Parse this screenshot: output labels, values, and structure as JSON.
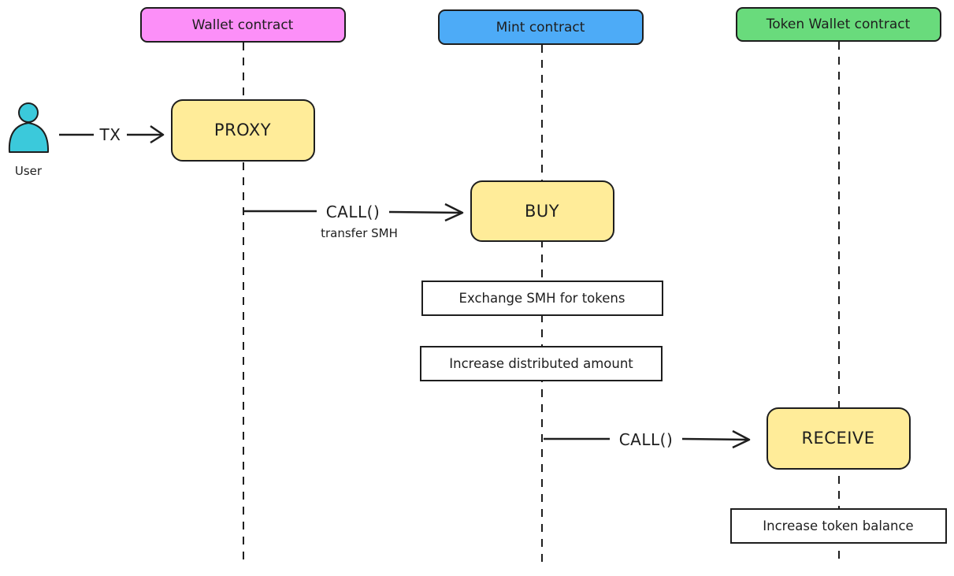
{
  "lanes": [
    {
      "title": "Wallet contract",
      "color": "#fc8ff8"
    },
    {
      "title": "Mint contract",
      "color": "#4dabf7"
    },
    {
      "title": "Token Wallet contract",
      "color": "#69db7c"
    }
  ],
  "actor": {
    "label": "User",
    "icon": "user-icon",
    "color": "#3bc9db"
  },
  "actions": {
    "proxy": "PROXY",
    "buy": "BUY",
    "receive": "RECEIVE",
    "fill": "#ffec99"
  },
  "arrows": {
    "tx": {
      "label": "TX"
    },
    "call_buy": {
      "label": "CALL()",
      "sublabel": "transfer SMH"
    },
    "call_receive": {
      "label": "CALL()"
    }
  },
  "notes": {
    "exchange": "Exchange SMH for tokens",
    "increase_distributed": "Increase distributed amount",
    "increase_balance": "Increase token balance"
  }
}
